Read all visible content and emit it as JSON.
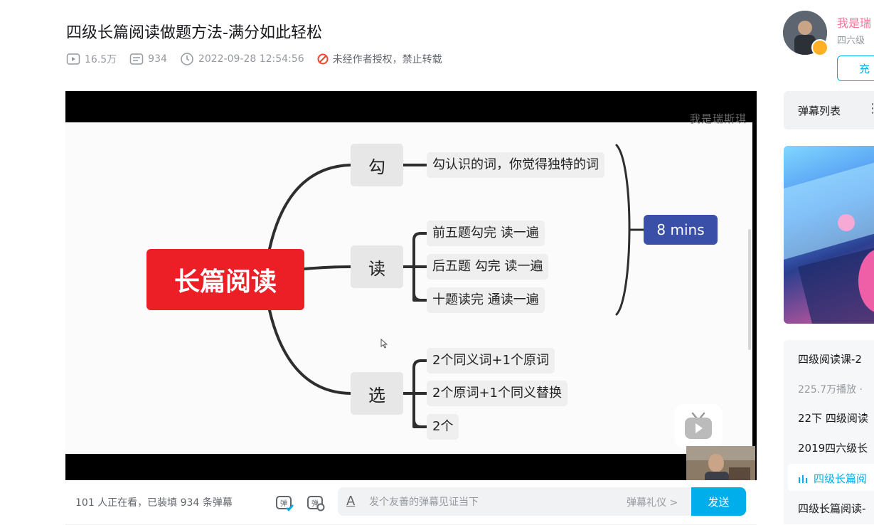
{
  "video": {
    "title": "四级长篇阅读做题方法-满分如此轻松",
    "views": "16.5万",
    "danmaku_count": "934",
    "publish_time": "2022-09-28 12:54:56",
    "copyright_notice": "未经作者授权，禁止转载"
  },
  "slide": {
    "watermark": "我是瑞斯琪",
    "central": "长篇阅读",
    "branches": [
      {
        "label": "勾",
        "leaves": [
          "勾认识的词，你觉得独特的词"
        ]
      },
      {
        "label": "读",
        "leaves": [
          "前五题勾完 读一遍",
          "后五题 勾完 读一遍",
          "十题读完 通读一遍"
        ]
      },
      {
        "label": "选",
        "leaves": [
          "2个同义词+1个原词",
          "2个原词+1个同义替换",
          "2个"
        ]
      }
    ],
    "time_box": "8  mins"
  },
  "bottom_bar": {
    "viewers_text": "101 人正在看，已装填 934 条弹幕",
    "danmaku_toggle_icon": "danmaku-toggle-icon",
    "danmaku_settings_icon": "danmaku-settings-icon",
    "input_placeholder": "发个友善的弹幕见证当下",
    "etiquette": "弹幕礼仪 >",
    "send": "发送"
  },
  "uploader": {
    "name": "我是瑞",
    "desc": "四六级",
    "charge_btn": "充"
  },
  "sidebar": {
    "danmaku_list": "弹幕列表",
    "more": "⋮",
    "playlist": [
      {
        "title": "四级阅读课-2",
        "type": "title"
      },
      {
        "title": "225.7万播放 ·",
        "type": "sub"
      },
      {
        "title": "22下 四级阅读",
        "type": "item"
      },
      {
        "title": "2019四六级长",
        "type": "item"
      },
      {
        "title": "四级长篇阅",
        "type": "active"
      },
      {
        "title": "四级长篇阅读-",
        "type": "item"
      }
    ]
  },
  "colors": {
    "accent": "#00aeec",
    "central_node": "#ec1f27",
    "time_box": "#3a4fa8",
    "uploader_name": "#fb7299"
  }
}
